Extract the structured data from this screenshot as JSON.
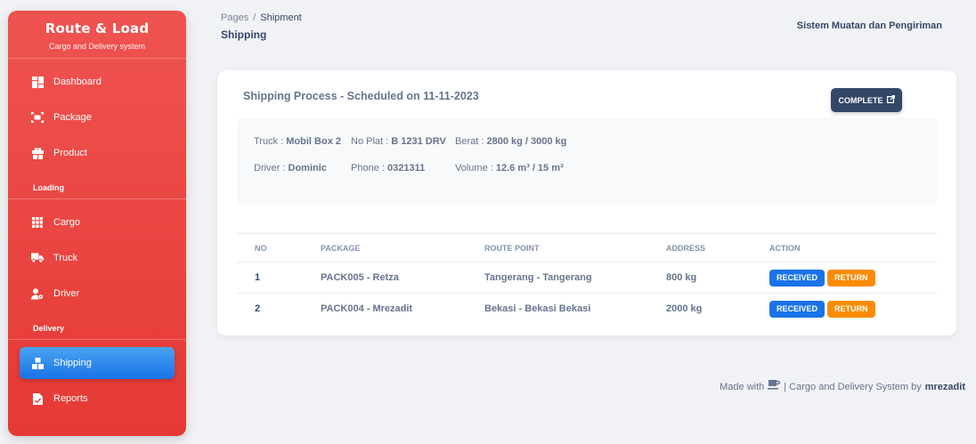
{
  "sidebar": {
    "brand_title": "Route & Load",
    "brand_subtitle": "Cargo and Delivery system",
    "items": [
      {
        "label": "Dashboard",
        "icon": "dashboard-icon"
      },
      {
        "label": "Package",
        "icon": "package-icon"
      },
      {
        "label": "Product",
        "icon": "product-icon"
      },
      {
        "label": "Cargo",
        "icon": "grid-icon"
      },
      {
        "label": "Truck",
        "icon": "truck-icon"
      },
      {
        "label": "Driver",
        "icon": "driver-icon"
      },
      {
        "label": "Shipping",
        "icon": "shipping-icon",
        "active": true
      },
      {
        "label": "Reports",
        "icon": "report-icon"
      }
    ],
    "sections": [
      "Loading",
      "Delivery"
    ]
  },
  "breadcrumb": {
    "root": "Pages",
    "current": "Shipment"
  },
  "page_title": "Shipping",
  "top_right": "Sistem Muatan dan Pengiriman",
  "shipping": {
    "title": "Shipping Process - Scheduled on 11-11-2023",
    "complete_label": "COMPLETE",
    "truck_label": "Truck : ",
    "truck": "Mobil Box 2",
    "plat_label": "No Plat : ",
    "plat": "B 1231 DRV",
    "berat_label": "Berat : ",
    "berat": "2800 kg / 3000 kg",
    "driver_label": "Driver : ",
    "driver": "Dominic",
    "phone_label": "Phone : ",
    "phone": "0321311",
    "volume_label": "Volume : ",
    "volume": "12.6 m³ / 15 m³"
  },
  "table": {
    "headers": [
      "NO",
      "PACKAGE",
      "ROUTE POINT",
      "ADDRESS",
      "ACTION"
    ],
    "rows": [
      {
        "no": "1",
        "package": "PACK005 - Retza",
        "route": "Tangerang - Tangerang",
        "address": "800 kg"
      },
      {
        "no": "2",
        "package": "PACK004 - Mrezadit",
        "route": "Bekasi - Bekasi Bekasi",
        "address": "2000 kg"
      }
    ],
    "received_label": "RECEIVED",
    "return_label": "RETURN"
  },
  "footer": {
    "made_with": "Made with",
    "middle": "| Cargo and Delivery System by",
    "author": "mrezadit"
  },
  "colors": {
    "sidebar": "#e53935",
    "active": "#1a73e8",
    "complete": "#344767",
    "received": "#1a73e8",
    "return": "#fb8c00"
  }
}
